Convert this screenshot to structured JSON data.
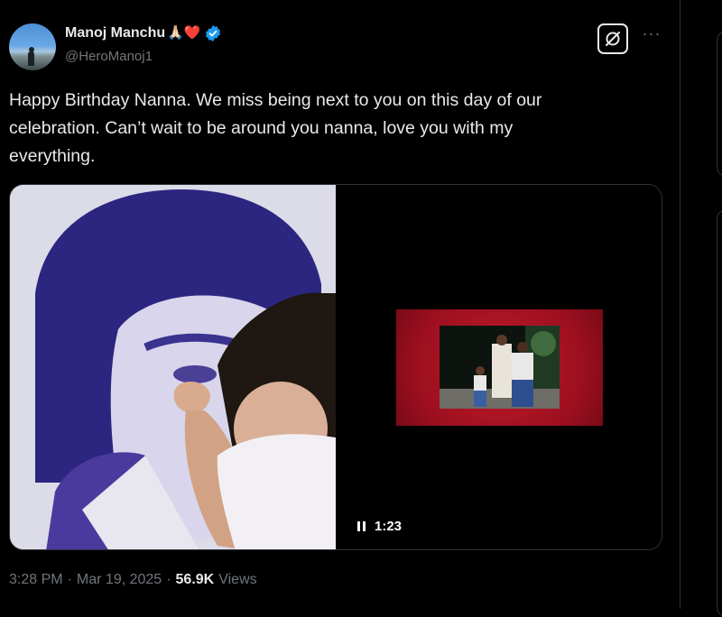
{
  "author": {
    "name": "Manoj Manchu",
    "emoji": "🙏🏻❤️",
    "handle": "@HeroManoj1",
    "avatar_icon": "avatar-photo",
    "verified_color": "#1d9bf0"
  },
  "actions": {
    "grok_icon": "grok-icon",
    "more_label": "···"
  },
  "tweet": {
    "text": "Happy Birthday Nanna. We miss being next to you on this day of our\ncelebration. Can’t wait to be around you nanna, love you with my\neverything."
  },
  "video": {
    "duration": "1:23",
    "state_icon": "pause-icon"
  },
  "meta": {
    "time": "3:28 PM",
    "separator": "·",
    "date": "Mar 19, 2025",
    "views_count": "56.9K",
    "views_label": "Views"
  },
  "colors": {
    "background": "#000000",
    "text_primary": "#e7e9ea",
    "text_secondary": "#71767b",
    "border": "#2f3336",
    "photo_tint": "#3b2f9a",
    "thumb_red": "#b3121f"
  }
}
